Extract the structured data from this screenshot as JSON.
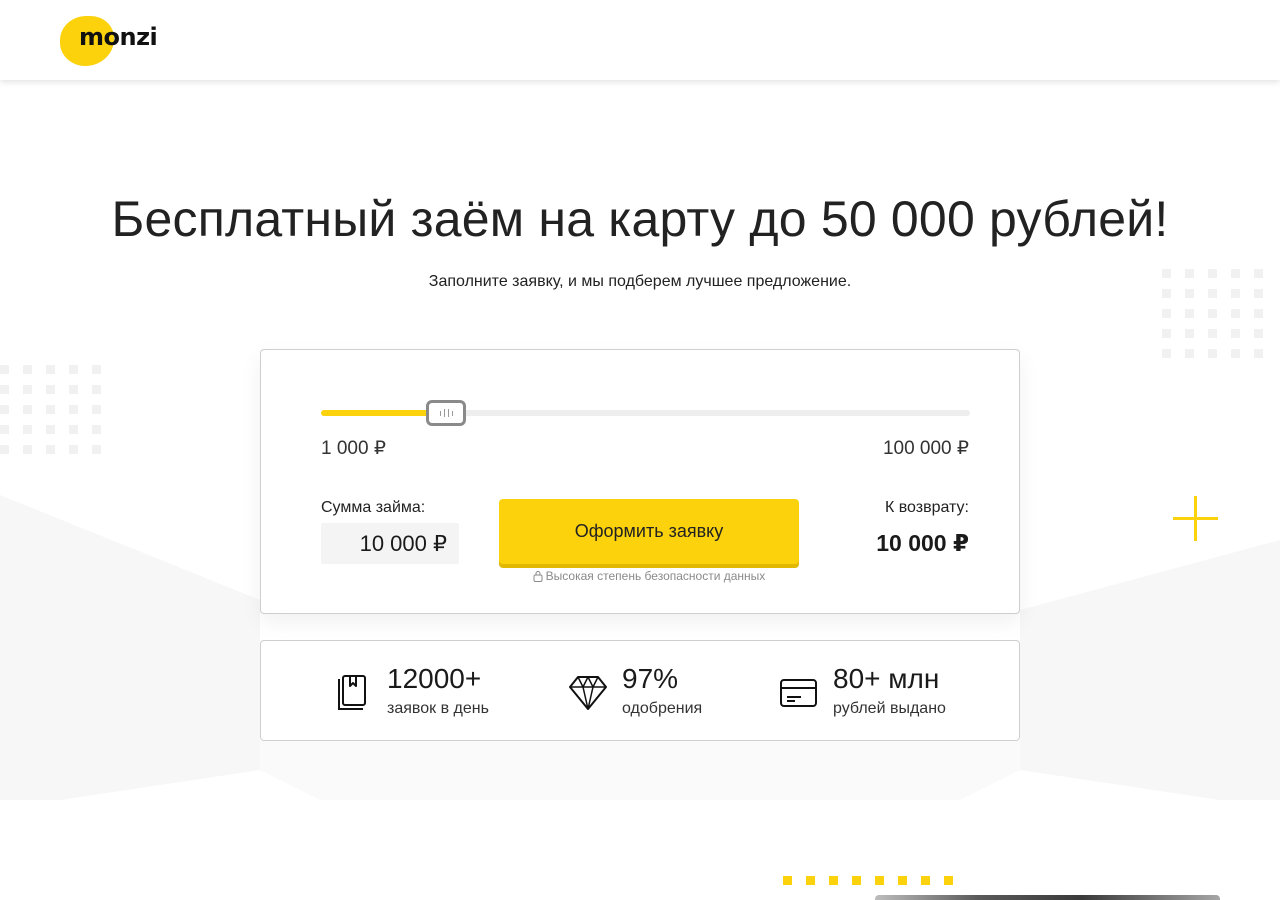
{
  "header": {
    "logo_text": "monzi"
  },
  "hero": {
    "title": "Бесплатный заём на карту до 50 000 рублей!",
    "subtitle": "Заполните заявку, и мы подберем лучшее предложение."
  },
  "calculator": {
    "slider": {
      "min_label": "1 000 ₽",
      "max_label": "100 000 ₽",
      "min": 1000,
      "max": 100000,
      "value": 10000
    },
    "amount_label": "Сумма займа:",
    "amount_value": "10 000 ₽",
    "cta_label": "Оформить заявку",
    "security_note": "Высокая степень безопасности данных",
    "return_label": "К возврату:",
    "return_value": "10 000 ₽"
  },
  "stats": [
    {
      "icon": "book-icon",
      "value": "12000+",
      "label": "заявок в день"
    },
    {
      "icon": "diamond-icon",
      "value": "97%",
      "label": "одобрения"
    },
    {
      "icon": "credit-card-icon",
      "value": "80+ млн",
      "label": "рублей выдано"
    }
  ],
  "colors": {
    "accent": "#fcd20c",
    "text": "#1a1a1a",
    "muted": "#8a8a8a"
  }
}
